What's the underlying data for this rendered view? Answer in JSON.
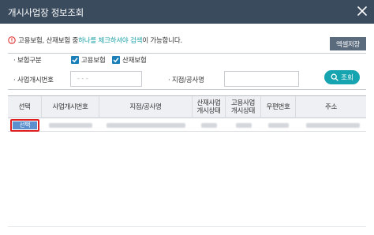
{
  "window": {
    "title": "개시사업장 정보조회"
  },
  "notice": {
    "before": "고용보험, 산재보험 중 ",
    "highlight": "하나를 체크하셔야 검색",
    "after": "이 가능합니다."
  },
  "toolbar": {
    "excel_label": "엑셀저장"
  },
  "filters": {
    "insurance_type_label": "보험구분",
    "employment_label": "고용보험",
    "employment_checked": true,
    "industrial_label": "산재보험",
    "industrial_checked": true,
    "business_no_label": "사업개시번호",
    "business_no_placeholder": "-  -  -",
    "branch_label": "지점/공사명",
    "search_label": "조회"
  },
  "table": {
    "headers": {
      "select": "선택",
      "business_no": "사업개시번호",
      "branch": "지점/공사명",
      "industrial_status_1": "산재사업",
      "industrial_status_2": "개시상태",
      "employment_status_1": "고용사업",
      "employment_status_2": "개시상태",
      "postal": "우편번호",
      "address": "주소"
    },
    "row_select_label": "선택"
  },
  "colors": {
    "titlebar": "#3b4b5e",
    "accent": "#16a4b0",
    "select_highlight": "#e02020"
  },
  "icons": {
    "close": "close-icon",
    "warning": "warning-icon",
    "check": "check-icon",
    "search": "search-icon"
  }
}
